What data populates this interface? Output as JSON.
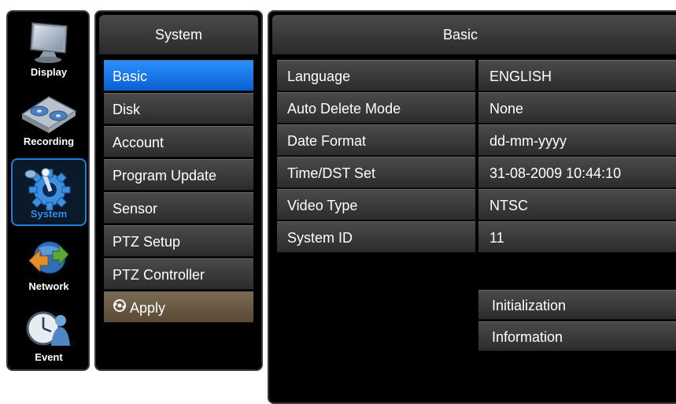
{
  "nav": {
    "items": [
      {
        "label": "Display",
        "icon": "monitor-icon"
      },
      {
        "label": "Recording",
        "icon": "film-reel-icon"
      },
      {
        "label": "System",
        "icon": "gear-joystick-icon",
        "active": true
      },
      {
        "label": "Network",
        "icon": "network-arrows-icon"
      },
      {
        "label": "Event",
        "icon": "clock-person-icon"
      }
    ]
  },
  "menu": {
    "title": "System",
    "items": [
      {
        "label": "Basic",
        "active": true
      },
      {
        "label": "Disk"
      },
      {
        "label": "Account"
      },
      {
        "label": "Program Update"
      },
      {
        "label": "Sensor"
      },
      {
        "label": "PTZ Setup"
      },
      {
        "label": "PTZ Controller"
      }
    ],
    "apply_label": "Apply"
  },
  "panel": {
    "title": "Basic",
    "settings": [
      {
        "label": "Language",
        "value": "ENGLISH"
      },
      {
        "label": "Auto Delete Mode",
        "value": "None"
      },
      {
        "label": "Date Format",
        "value": "dd-mm-yyyy"
      },
      {
        "label": "Time/DST Set",
        "value": "31-08-2009 10:44:10"
      },
      {
        "label": "Video Type",
        "value": "NTSC"
      },
      {
        "label": "System ID",
        "value": "11"
      }
    ],
    "initialization_label": "Initialization",
    "information_label": "Information"
  },
  "colors": {
    "accent": "#1f7fd6",
    "selected_item": "#1a6fe0",
    "apply_button": "#6b5b44",
    "background": "#000000"
  }
}
